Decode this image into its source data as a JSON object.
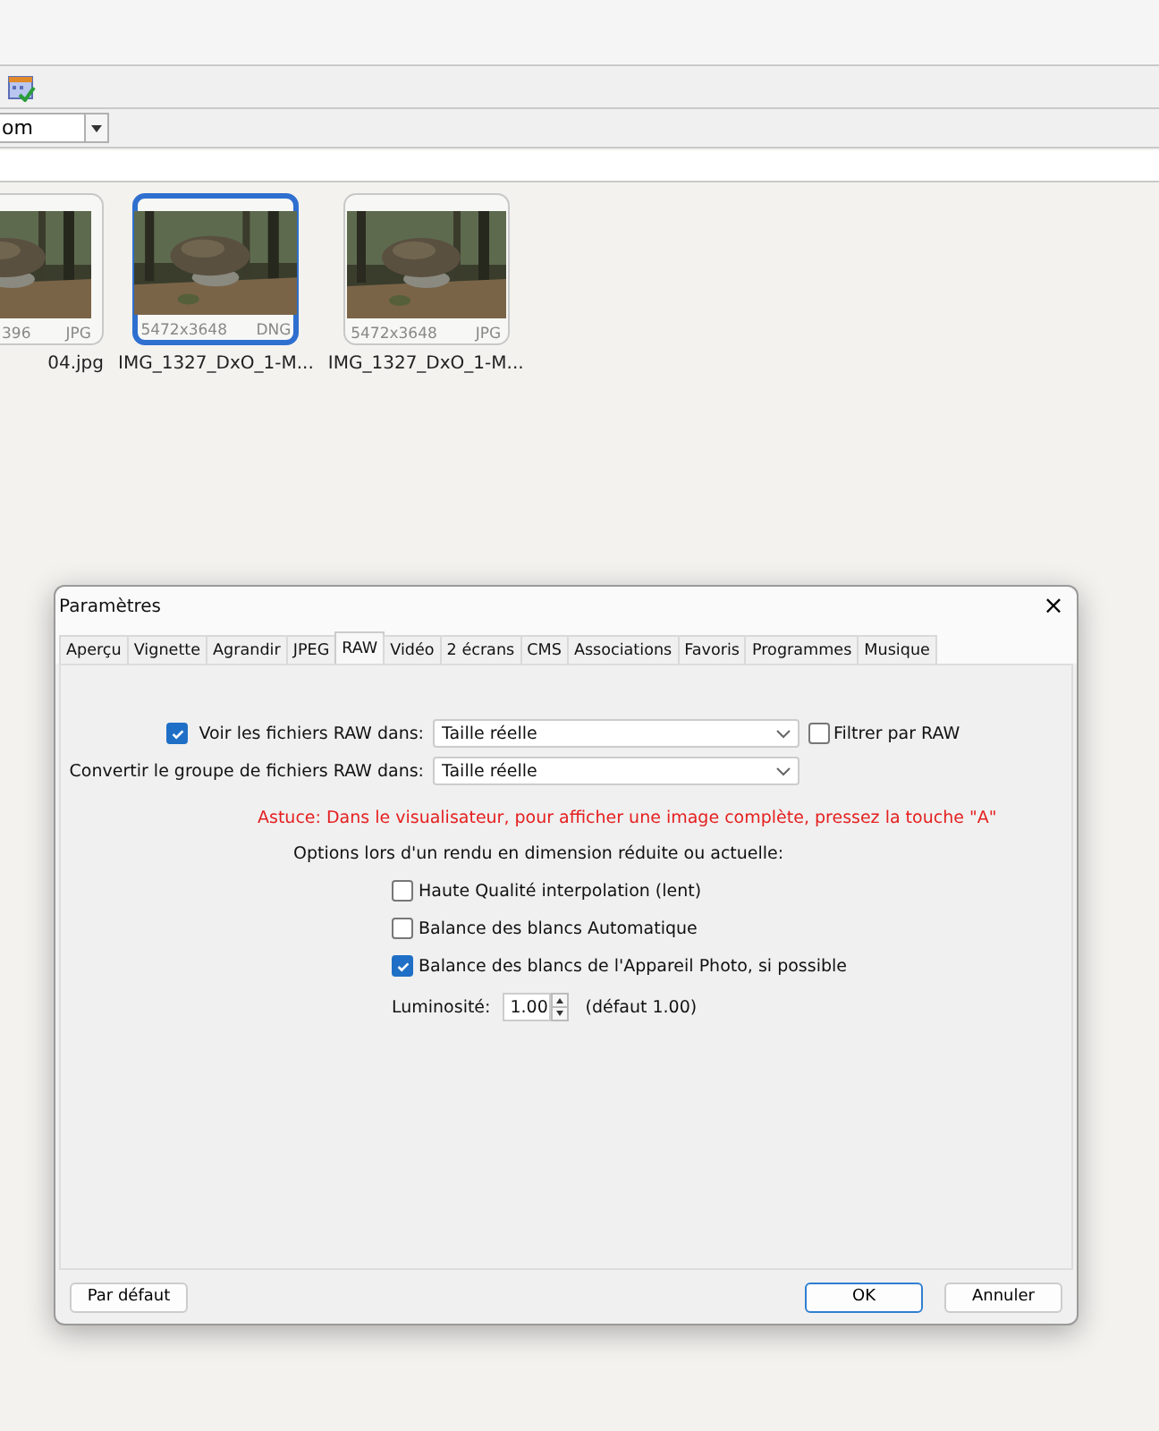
{
  "combo": {
    "value": "om"
  },
  "thumbnails": [
    {
      "kind": "partial",
      "dimensions": "396",
      "format": "JPG",
      "filename": "04.jpg",
      "selected": false
    },
    {
      "kind": "full",
      "dimensions": "5472x3648",
      "format": "DNG",
      "filename": "IMG_1327_DxO_1-M...",
      "selected": true
    },
    {
      "kind": "full",
      "dimensions": "5472x3648",
      "format": "JPG",
      "filename": "IMG_1327_DxO_1-M...",
      "selected": false
    }
  ],
  "dialog": {
    "title": "Paramètres",
    "close": "×",
    "tabs": [
      {
        "label": "Aperçu",
        "selected": false
      },
      {
        "label": "Vignette",
        "selected": false
      },
      {
        "label": "Agrandir",
        "selected": false
      },
      {
        "label": "JPEG",
        "selected": false
      },
      {
        "label": "RAW",
        "selected": true
      },
      {
        "label": "Vidéo",
        "selected": false
      },
      {
        "label": "2 écrans",
        "selected": false
      },
      {
        "label": "CMS",
        "selected": false
      },
      {
        "label": "Associations",
        "selected": false
      },
      {
        "label": "Favoris",
        "selected": false
      },
      {
        "label": "Programmes",
        "selected": false
      },
      {
        "label": "Musique",
        "selected": false
      }
    ],
    "view_raw": {
      "label": "Voir les fichiers RAW dans:",
      "checked": true,
      "value": "Taille réelle"
    },
    "filter_raw": {
      "label": "Filtrer par RAW",
      "checked": false
    },
    "convert_raw": {
      "label": "Convertir le groupe de fichiers RAW dans:",
      "value": "Taille réelle"
    },
    "tip": "Astuce: Dans le visualisateur, pour afficher une image complète, pressez la touche \"A\"",
    "options_heading": "Options lors d'un rendu en dimension réduite ou actuelle:",
    "options": [
      {
        "label": "Haute Qualité interpolation (lent)",
        "checked": false
      },
      {
        "label": "Balance des blancs Automatique",
        "checked": false
      },
      {
        "label": "Balance des blancs de l'Appareil Photo, si possible",
        "checked": true
      }
    ],
    "brightness": {
      "label": "Luminosité:",
      "value": "1.00",
      "default": "(défaut 1.00)"
    },
    "buttons": [
      {
        "label": "Par défaut",
        "kind": "secondary"
      },
      {
        "label": "OK",
        "kind": "primary"
      },
      {
        "label": "Annuler",
        "kind": "secondary"
      }
    ]
  }
}
